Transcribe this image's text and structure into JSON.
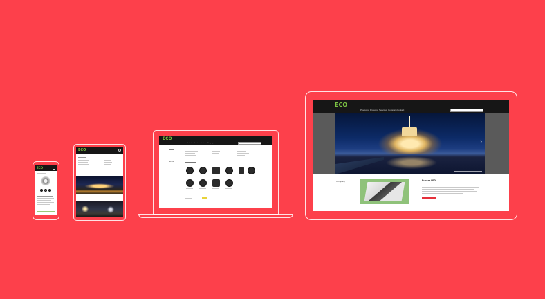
{
  "brand": {
    "logo_text": "ECO",
    "logo_color": "#7bc142",
    "background_color": "#fd404b"
  },
  "desktop": {
    "nav_items": [
      "Products",
      "Projects",
      "Services",
      "Company",
      "Contact"
    ],
    "hero_nav_arrow": "›",
    "side_label": "Company",
    "feature_title": "Bunker LED"
  },
  "laptop": {
    "section_label": "Series"
  },
  "icons": [
    "search-icon",
    "menu-icon",
    "chevron-right-icon"
  ]
}
